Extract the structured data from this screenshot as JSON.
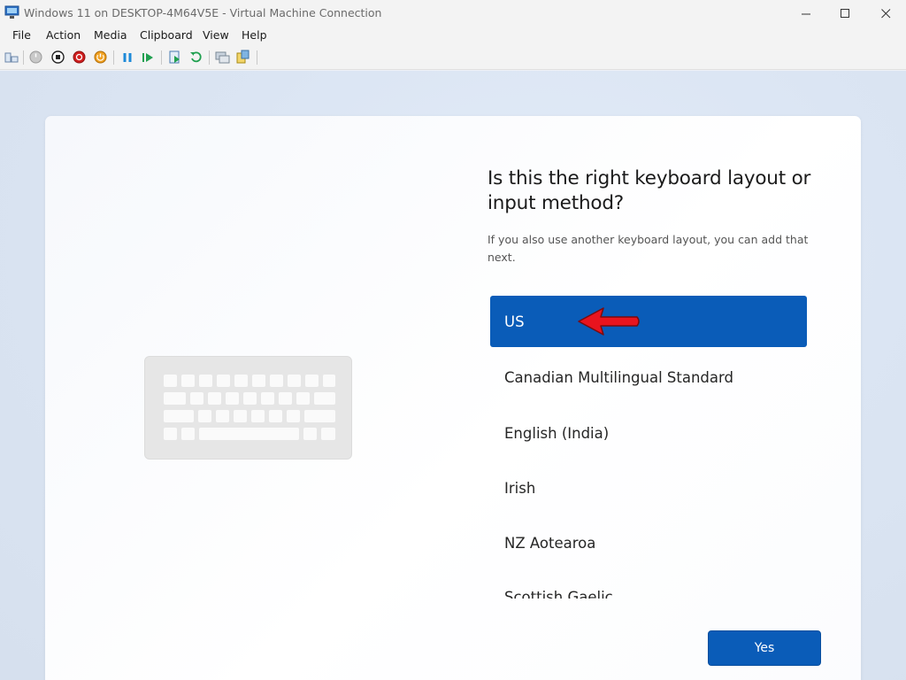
{
  "window": {
    "title": "Windows 11 on DESKTOP-4M64V5E - Virtual Machine Connection",
    "controls": [
      "minimize-icon",
      "maximize-icon",
      "close-icon"
    ]
  },
  "menu": {
    "items": [
      "File",
      "Action",
      "Media",
      "Clipboard",
      "View",
      "Help"
    ]
  },
  "toolbar": {
    "icons": [
      "ctrl-alt-del-icon",
      "start-icon",
      "turn-off-icon",
      "shutdown-icon",
      "save-icon",
      "pause-icon",
      "resume-icon",
      "checkpoint-icon",
      "revert-icon",
      "enhanced-session-icon",
      "share-icon"
    ]
  },
  "oobe": {
    "heading": "Is this the right keyboard layout or input method?",
    "subtext": "If you also use another keyboard layout, you can add that next.",
    "layouts": [
      "US",
      "Canadian Multilingual Standard",
      "English (India)",
      "Irish",
      "NZ Aotearoa",
      "Scottish Gaelic"
    ],
    "selected": "US",
    "yes_label": "Yes"
  },
  "colors": {
    "accent": "#0a5cb8",
    "arrow": "#e8141e"
  }
}
